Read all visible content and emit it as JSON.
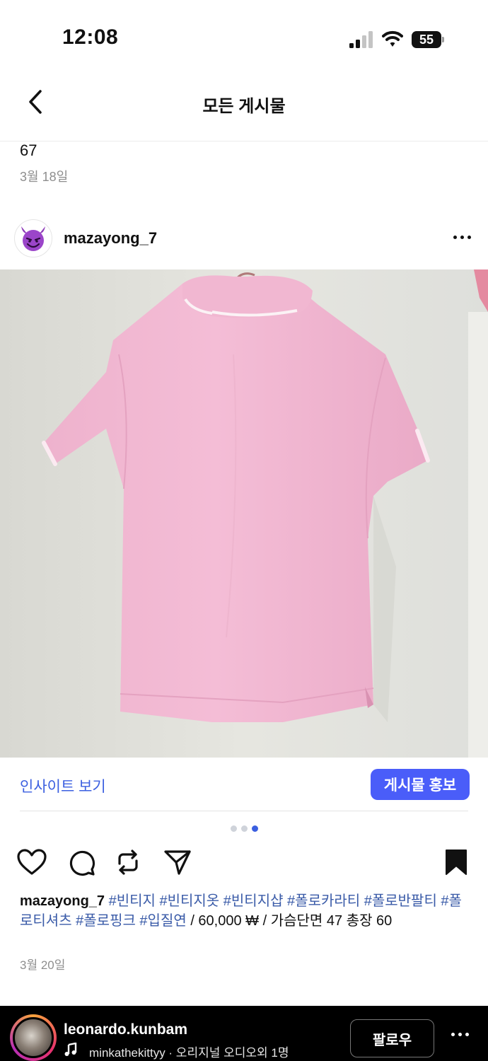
{
  "status_bar": {
    "time": "12:08",
    "battery": "55"
  },
  "nav": {
    "title": "모든 게시물"
  },
  "previous_post": {
    "likes": "67",
    "date": "3월 18일"
  },
  "post": {
    "username": "mazayong_7",
    "avatar_emoji": "😈",
    "image_description_icon": "pink-polo-shirt-photo",
    "insights_label": "인사이트 보기",
    "promote_label": "게시물 홍보",
    "carousel": {
      "total": 3,
      "active_index": 3
    },
    "caption_user": "mazayong_7",
    "caption_tags": "#빈티지 #빈티지옷 #빈티지샵 #폴로카라티 #폴로반팔티 #폴로티셔츠 #폴로핑크 #입질연",
    "caption_text": " / 60,000 ₩ / 가슴단면 47 총장 60",
    "date": "3월 20일"
  },
  "reel_bar": {
    "username": "leonardo.kunbam",
    "audio": "minkathekittyy · 오리지널 오디오외 1명",
    "follow_label": "팔로우"
  },
  "colors": {
    "accent": "#4a5df9",
    "link": "#3b5fe0",
    "hashtag": "#3a5ba8",
    "shirt": "#f2b8d2"
  }
}
